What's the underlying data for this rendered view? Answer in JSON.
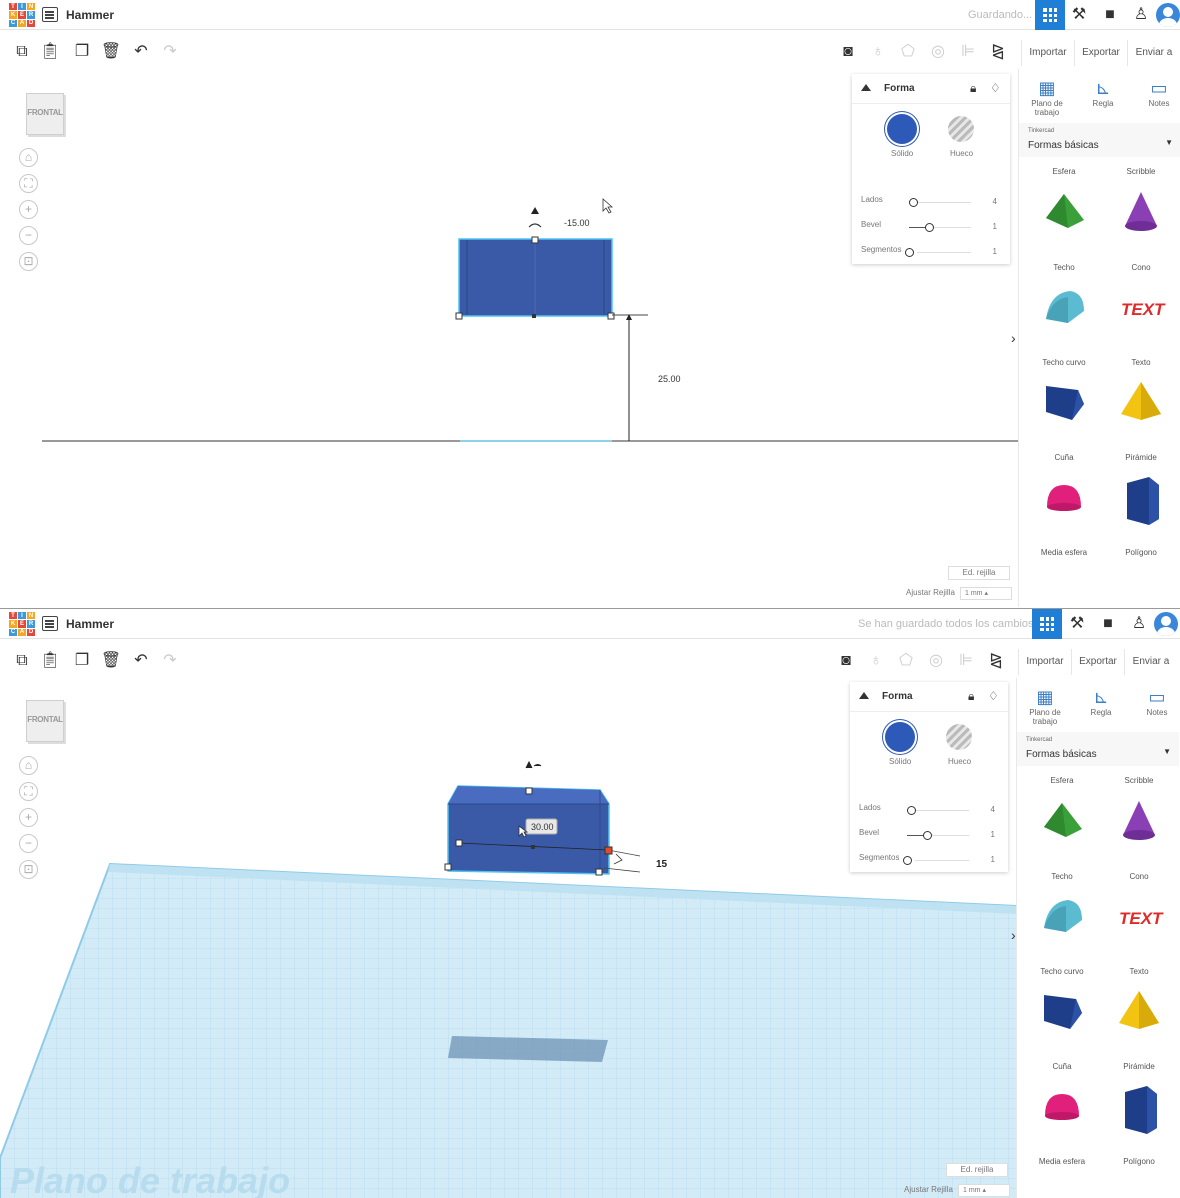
{
  "app": {
    "logo_letters": [
      "T",
      "I",
      "N",
      "K",
      "E",
      "R",
      "C",
      "A",
      "D"
    ],
    "project_title": "Hammer"
  },
  "screens": [
    {
      "save_status": "Guardando...",
      "dimension_top_value": "-15.00",
      "dimension_height_value": "25.00",
      "cube_label": "FRONTAL"
    },
    {
      "save_status": "Se han guardado todos los cambios.",
      "dimension_width_value": "30.00",
      "dimension_depth_value": "15",
      "cube_label": "FRONTAL",
      "workplane_watermark": "Plano de trabajo"
    }
  ],
  "toolbar": {
    "import_label": "Importar",
    "export_label": "Exportar",
    "send_label": "Enviar a"
  },
  "shape_panel": {
    "title": "Forma",
    "solid_label": "Sólido",
    "hole_label": "Hueco",
    "sliders": [
      {
        "label": "Lados",
        "value": "4",
        "fraction": 0.0
      },
      {
        "label": "Bevel",
        "value": "1",
        "fraction": 0.35
      },
      {
        "label": "Segmentos",
        "value": "1",
        "fraction": 0.0
      }
    ]
  },
  "library": {
    "workplane_label": "Plano de trabajo",
    "ruler_label": "Regla",
    "notes_label": "Notes",
    "source_small": "Tinkercad",
    "source_value": "Formas básicas",
    "top_cats": [
      "Esfera",
      "Scribble"
    ],
    "shapes": [
      {
        "name": "Techo",
        "icon": "roof-icon",
        "color": "#3aa03a"
      },
      {
        "name": "Cono",
        "icon": "cone-icon",
        "color": "#8a3fb5"
      },
      {
        "name": "Techo curvo",
        "icon": "round-roof-icon",
        "color": "#5bbbd0"
      },
      {
        "name": "Texto",
        "icon": "text-icon",
        "color": "#e02a2a"
      },
      {
        "name": "Cuña",
        "icon": "wedge-icon",
        "color": "#1f3e8a"
      },
      {
        "name": "Pirámide",
        "icon": "pyramid-icon",
        "color": "#f2c311"
      },
      {
        "name": "Media esfera",
        "icon": "half-sphere-icon",
        "color": "#e0207a"
      },
      {
        "name": "Polígono",
        "icon": "polygon-icon",
        "color": "#1f3e8a"
      }
    ],
    "text_shape_glyph": "TEXT"
  },
  "grid_controls": {
    "edit_grid_label": "Ed. rejilla",
    "snap_label": "Ajustar Rejilla",
    "snap_value": "1 mm"
  },
  "colors": {
    "accent": "#1f7fd6",
    "box_fill": "#3a5aa8",
    "box_edge": "#4ec3f0",
    "workplane": "#cfe8f5"
  }
}
